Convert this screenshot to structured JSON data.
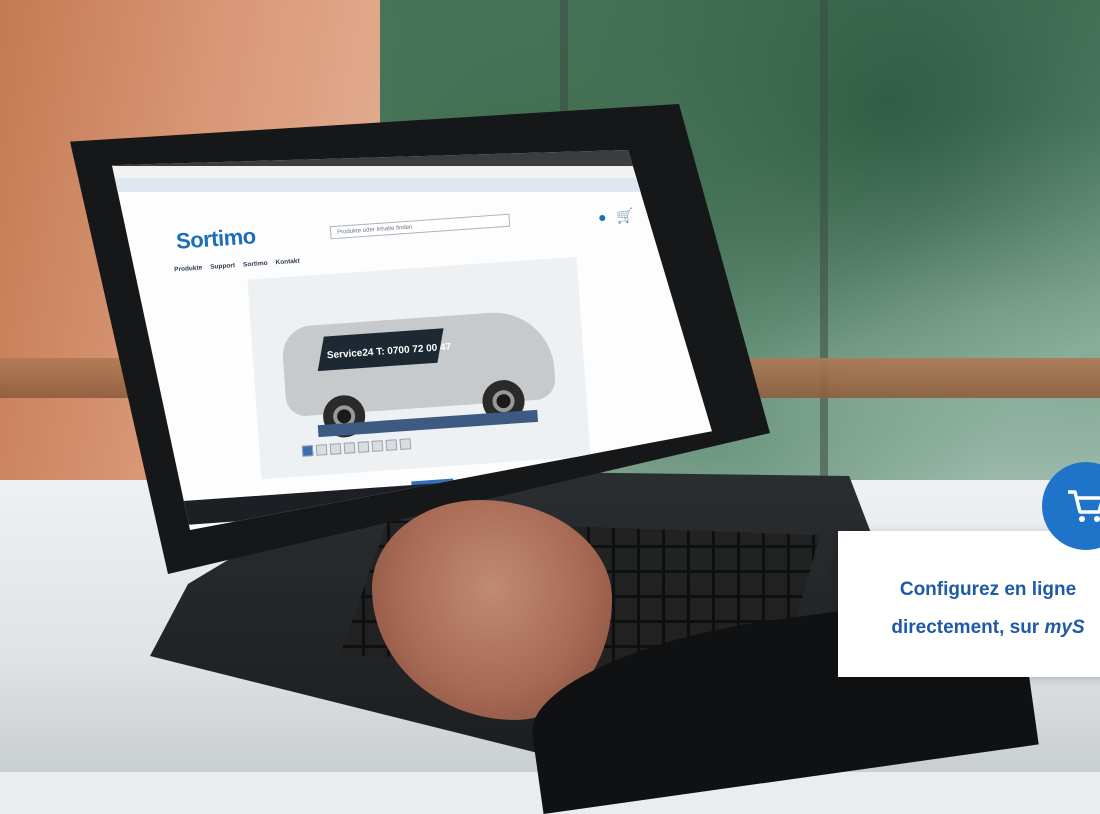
{
  "site": {
    "logo_text": "Sortimo",
    "search_placeholder": "Produkte oder Inhalte finden",
    "nav": [
      "Produkte",
      "Support",
      "Sortimo",
      "Kontakt"
    ],
    "van_text": "Service24 T: 0700 72 00 47"
  },
  "overlay": {
    "line1": "Configurez en ligne",
    "line2_prefix": "directement, sur ",
    "line2_emph": "myS",
    "icon": "shopping-cart-icon",
    "accent_color": "#1f73c8"
  }
}
